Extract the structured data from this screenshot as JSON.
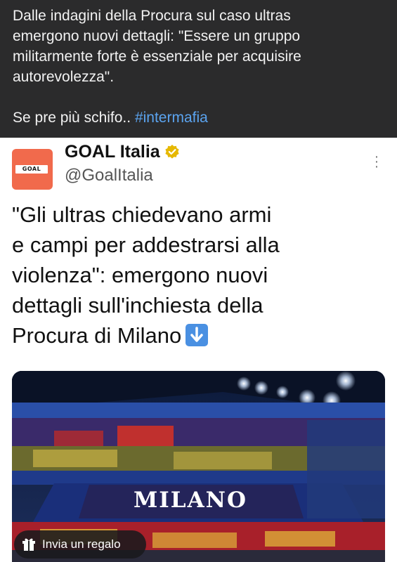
{
  "quote_post": {
    "line1": "Dalle indagini della Procura sul caso ultras",
    "line2": "emergono nuovi dettagli: \"Essere un gruppo",
    "line3": "militarmente forte è essenziale per acquisire",
    "line4": "autorevolezza\".",
    "comment_text": "Se pre più schifo.. ",
    "hashtag": "#intermafia"
  },
  "embedded_post": {
    "avatar_logo_text": "GOAL",
    "account_name": "GOAL Italia",
    "handle": "@GoalItalia",
    "text_lines": [
      "\"Gli ultras chiedevano armi",
      "e campi per addestrarsi alla",
      "violenza\": emergono nuovi",
      "dettagli sull'inchiesta della",
      "Procura di Milano"
    ],
    "media": {
      "banner_text": "MILANO"
    }
  },
  "gift_button": {
    "label": "Invia un regalo"
  },
  "icons": {
    "verified": "verified-badge-icon",
    "more": "more-options-icon",
    "arrow": "down-arrow-emoji-icon",
    "gift": "gift-icon"
  },
  "colors": {
    "top_background": "#2b2b2c",
    "hashtag": "#5ba4f0",
    "avatar": "#f16a4c",
    "verified": "#e6b800"
  }
}
